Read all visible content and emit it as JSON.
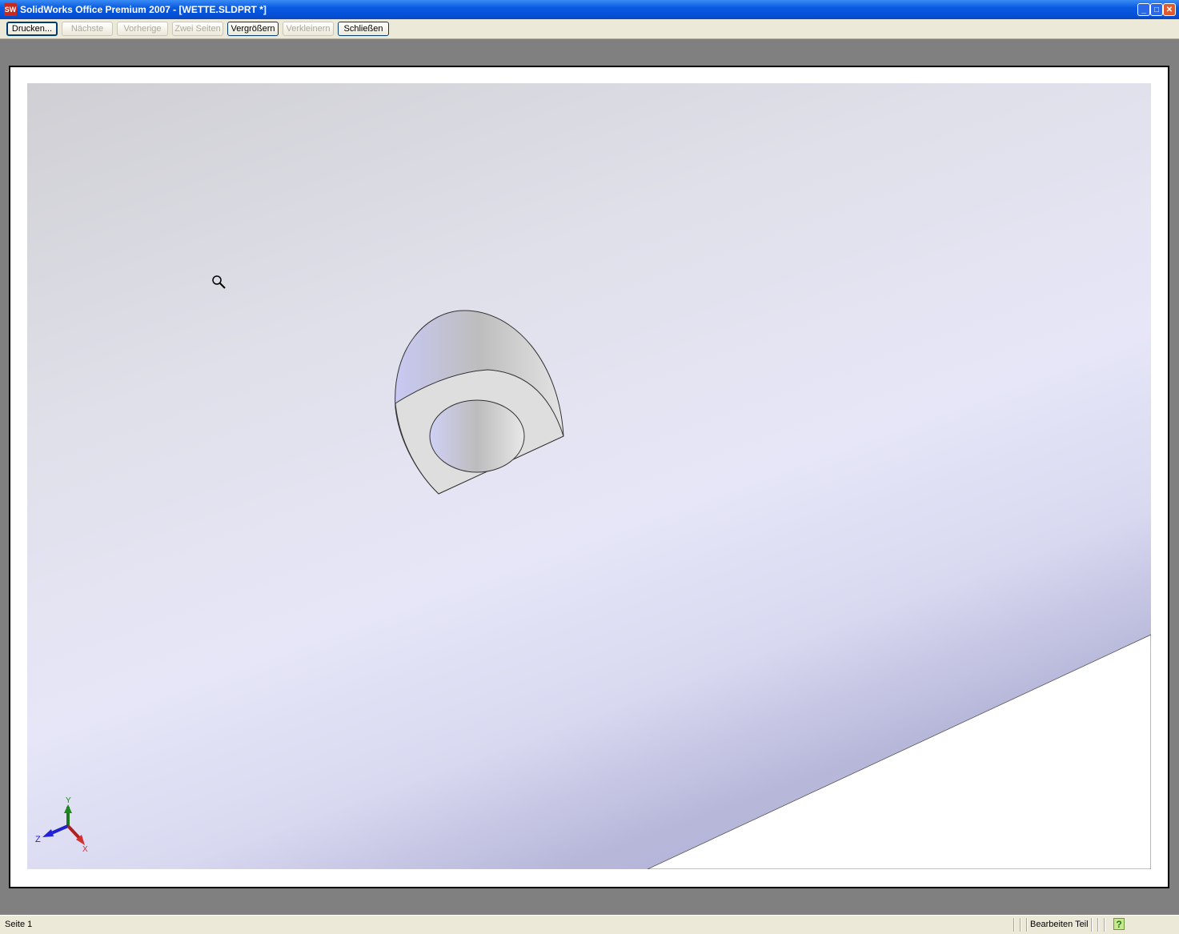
{
  "window": {
    "title": "SolidWorks Office Premium 2007 - [WETTE.SLDPRT *]",
    "logo": "SW"
  },
  "toolbar": {
    "buttons": [
      {
        "label": "Drucken...",
        "enabled": true
      },
      {
        "label": "Nächste",
        "enabled": false
      },
      {
        "label": "Vorherige",
        "enabled": false
      },
      {
        "label": "Zwei Seiten",
        "enabled": false
      },
      {
        "label": "Vergrößern",
        "enabled": true
      },
      {
        "label": "Verkleinern",
        "enabled": false
      },
      {
        "label": "Schließen",
        "enabled": true
      }
    ]
  },
  "triad": {
    "x": "X",
    "y": "Y",
    "z": "Z"
  },
  "status": {
    "page": "Seite 1",
    "mode": "Bearbeiten Teil",
    "help": "?"
  }
}
